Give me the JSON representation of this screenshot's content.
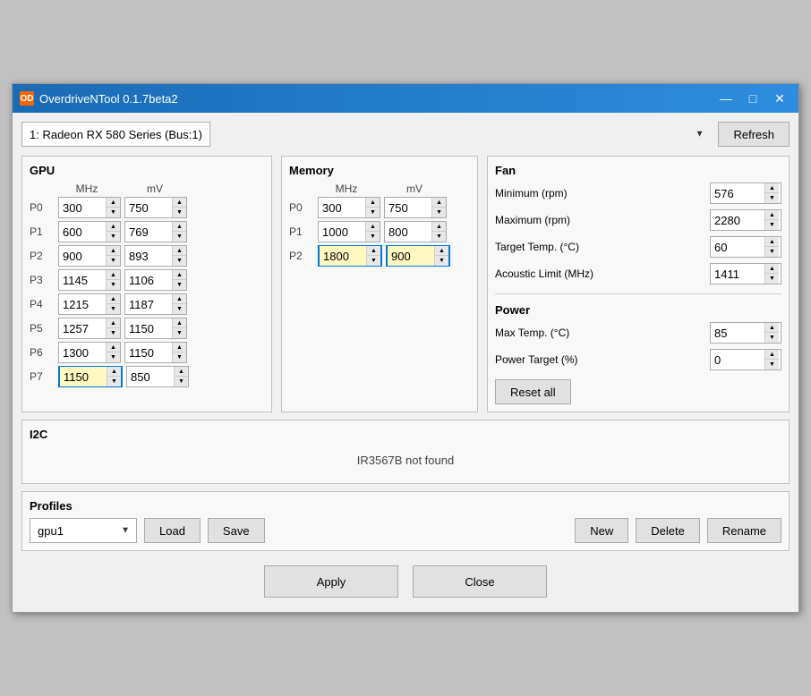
{
  "window": {
    "title": "OverdriveNTool 0.1.7beta2",
    "icon": "OD"
  },
  "titlebar": {
    "minimize_label": "—",
    "maximize_label": "□",
    "close_label": "✕"
  },
  "gpu_dropdown": {
    "value": "1: Radeon RX 580 Series  (Bus:1)",
    "options": [
      "1: Radeon RX 580 Series  (Bus:1)"
    ]
  },
  "refresh_button": "Refresh",
  "gpu_section": {
    "title": "GPU",
    "col_mhz": "MHz",
    "col_mv": "mV",
    "rows": [
      {
        "label": "P0",
        "mhz": "300",
        "mv": "750",
        "highlighted": false
      },
      {
        "label": "P1",
        "mhz": "600",
        "mv": "769",
        "highlighted": false
      },
      {
        "label": "P2",
        "mhz": "900",
        "mv": "893",
        "highlighted": false
      },
      {
        "label": "P3",
        "mhz": "1145",
        "mv": "1106",
        "highlighted": false
      },
      {
        "label": "P4",
        "mhz": "1215",
        "mv": "1187",
        "highlighted": false
      },
      {
        "label": "P5",
        "mhz": "1257",
        "mv": "1150",
        "highlighted": false
      },
      {
        "label": "P6",
        "mhz": "1300",
        "mv": "1150",
        "highlighted": false
      },
      {
        "label": "P7",
        "mhz": "1150",
        "mv": "850",
        "highlighted": true
      }
    ]
  },
  "memory_section": {
    "title": "Memory",
    "col_mhz": "MHz",
    "col_mv": "mV",
    "rows": [
      {
        "label": "P0",
        "mhz": "300",
        "mv": "750",
        "highlighted": false
      },
      {
        "label": "P1",
        "mhz": "1000",
        "mv": "800",
        "highlighted": false
      },
      {
        "label": "P2",
        "mhz": "1800",
        "mv": "900",
        "highlighted": true
      }
    ]
  },
  "fan_section": {
    "title": "Fan",
    "fields": [
      {
        "label": "Minimum (rpm)",
        "value": "576"
      },
      {
        "label": "Maximum (rpm)",
        "value": "2280"
      },
      {
        "label": "Target Temp. (°C)",
        "value": "60"
      },
      {
        "label": "Acoustic Limit (MHz)",
        "value": "1411"
      }
    ]
  },
  "power_section": {
    "title": "Power",
    "fields": [
      {
        "label": "Max Temp. (°C)",
        "value": "85"
      },
      {
        "label": "Power Target (%)",
        "value": "0"
      }
    ]
  },
  "reset_all_button": "Reset all",
  "i2c_section": {
    "title": "I2C",
    "message": "IR3567B not found"
  },
  "profiles_section": {
    "title": "Profiles",
    "selected": "gpu1",
    "options": [
      "gpu1"
    ],
    "load_button": "Load",
    "save_button": "Save",
    "new_button": "New",
    "delete_button": "Delete",
    "rename_button": "Rename"
  },
  "bottom_buttons": {
    "apply": "Apply",
    "close": "Close"
  }
}
